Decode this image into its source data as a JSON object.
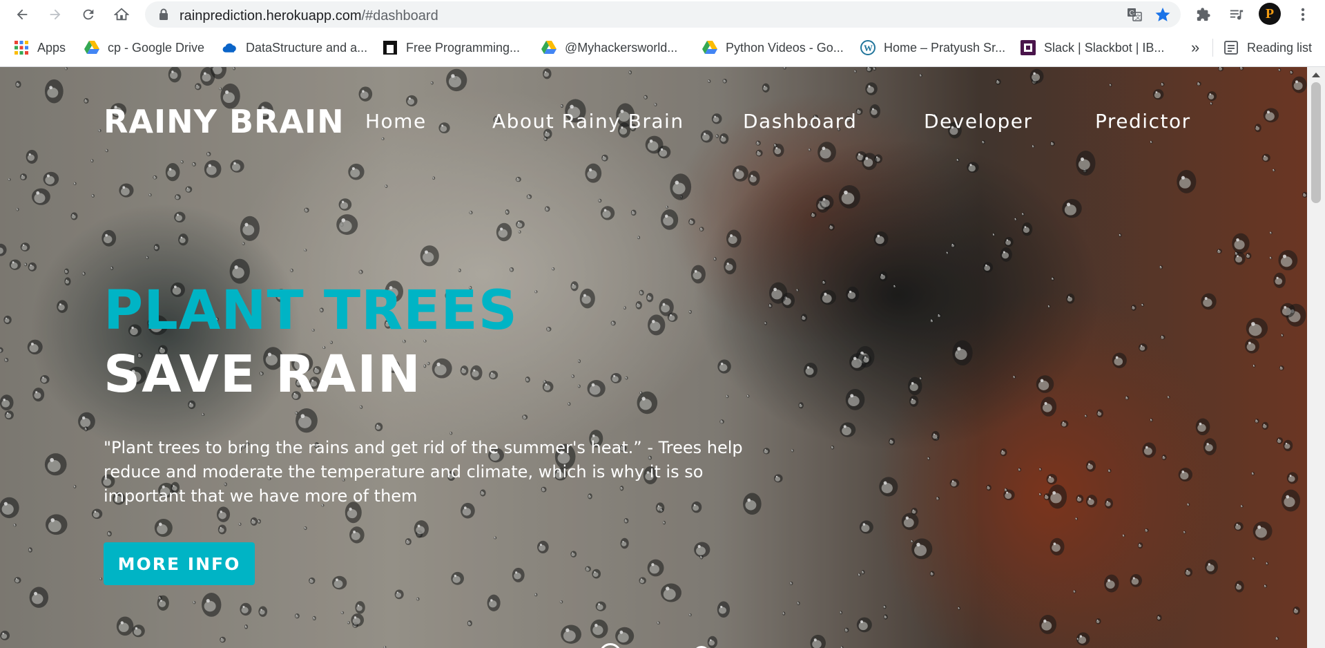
{
  "browser": {
    "url_host": "rainprediction.herokuapp.com",
    "url_path": "/#dashboard",
    "bookmarks": [
      {
        "label": "Apps",
        "icon": "apps-grid-icon"
      },
      {
        "label": "cp - Google Drive",
        "icon": "google-drive-icon"
      },
      {
        "label": "DataStructure and a...",
        "icon": "onedrive-icon"
      },
      {
        "label": "Free Programming...",
        "icon": "page-icon"
      },
      {
        "label": "@Myhackersworld...",
        "icon": "google-drive-icon"
      },
      {
        "label": "Python Videos - Go...",
        "icon": "google-drive-icon"
      },
      {
        "label": "Home – Pratyush Sr...",
        "icon": "wordpress-icon"
      },
      {
        "label": "Slack | Slackbot | IB...",
        "icon": "slack-icon"
      }
    ],
    "more_bookmarks": "»",
    "reading_list": "Reading list",
    "avatar_letter": "P"
  },
  "site": {
    "logo": "RAINY BRAIN",
    "nav": [
      "Home",
      "About Rainy Brain",
      "Dashboard",
      "Developer",
      "Predictor"
    ],
    "hero": {
      "title_line1": "PLANT TREES",
      "title_line2": "SAVE RAIN",
      "text": "\"Plant trees to bring the rains and get rid of the summer's heat.” - Trees help reduce and moderate the temperature and climate, which is why it is so important that we have more of them",
      "cta": "MORE INFO"
    }
  },
  "colors": {
    "accent": "#00b4c5",
    "star": "#1a73e8"
  }
}
